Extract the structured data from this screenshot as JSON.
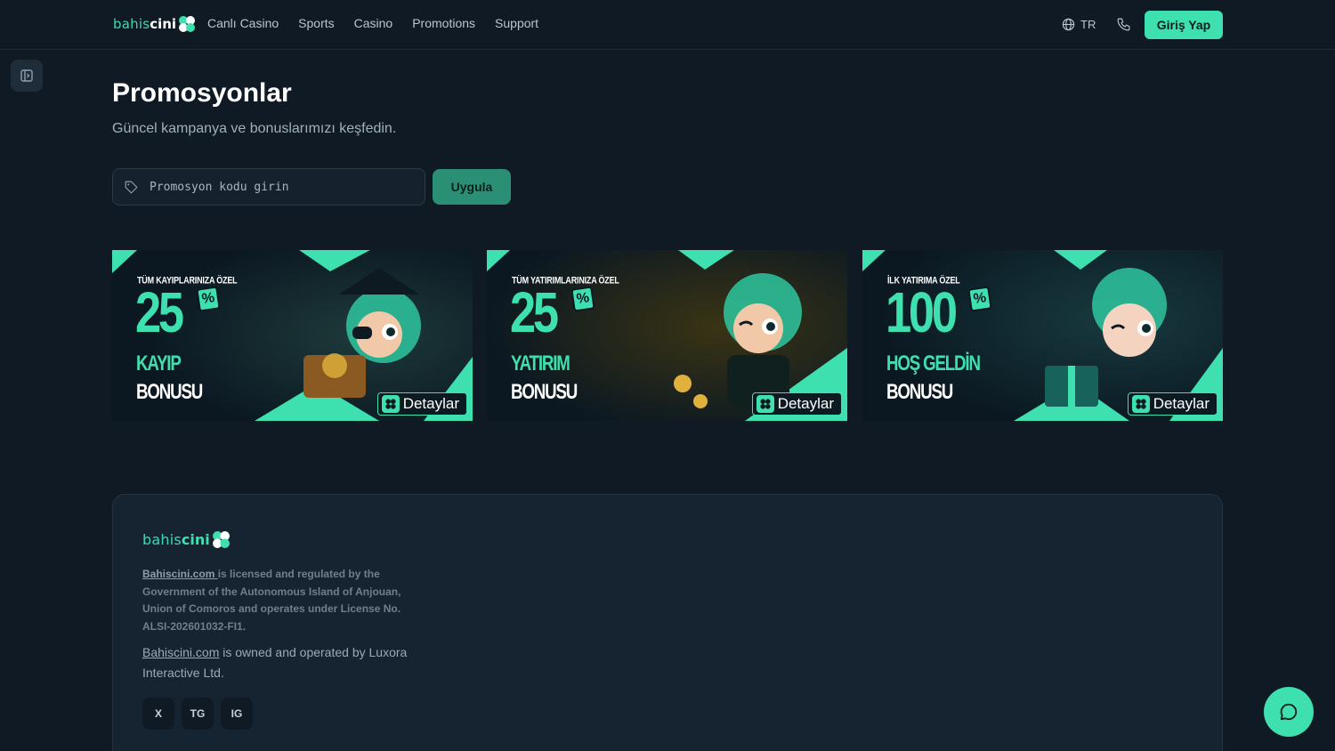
{
  "header": {
    "brand_a": "bahis",
    "brand_b": "cini",
    "nav": [
      "Canlı Casino",
      "Sports",
      "Casino",
      "Promotions",
      "Support"
    ],
    "lang": "TR",
    "login_label": "Giriş Yap",
    "icons": [
      "logo-clover-icon",
      "globe-icon",
      "phone-icon"
    ]
  },
  "page": {
    "title": "Promosyonlar",
    "subtitle": "Güncel kampanya ve bonuslarımızı keşfedin.",
    "promo_placeholder": "Promosyon kodu girin",
    "apply_label": "Uygula"
  },
  "banners": [
    {
      "tag": "TÜM KAYIPLARINIZA ÖZEL",
      "amount": "25",
      "pct": "%",
      "line1": "KAYIP",
      "line2": "BONUSU",
      "cta": "Detaylar"
    },
    {
      "tag": "TÜM YATIRIMLARINIZA ÖZEL",
      "amount": "25",
      "pct": "%",
      "line1": "YATIRIM",
      "line2": "BONUSU",
      "cta": "Detaylar"
    },
    {
      "tag": "İLK YATIRIMA ÖZEL",
      "amount": "100",
      "pct": "%",
      "line1": "HOŞ GELDİN",
      "line2": "BONUSU",
      "cta": "Detaylar"
    }
  ],
  "footer": {
    "brand_a": "bahis",
    "brand_b": "cini",
    "legal_link": "Bahiscini.com ",
    "legal_text": "is licensed and regulated by the Government of the Autonomous Island of Anjouan, Union of Comoros and operates under License No. ALSI-202601032-FI1.",
    "owned_link": "Bahiscini.com",
    "owned_text": " is owned and operated by Luxora Interactive Ltd.",
    "socials": [
      "X",
      "TG",
      "IG"
    ]
  },
  "colors": {
    "accent": "#3ee0b0",
    "background": "#0f1a24",
    "panel": "#152430"
  }
}
